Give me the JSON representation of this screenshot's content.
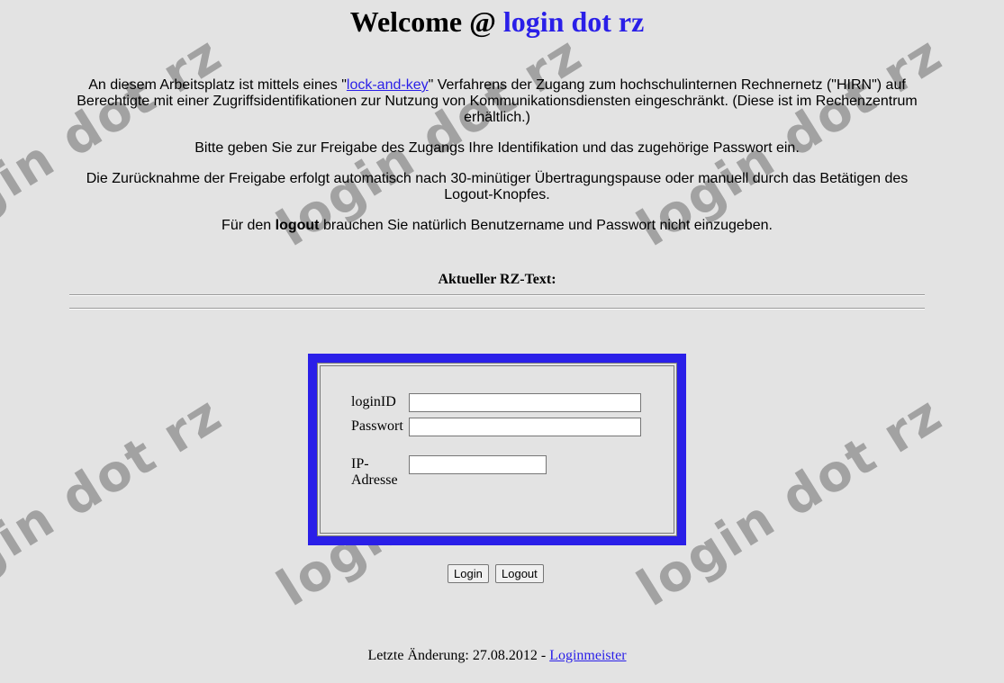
{
  "watermark": {
    "text": "login dot rz"
  },
  "header": {
    "welcome_prefix": "Welcome @ ",
    "brand": "login dot rz"
  },
  "intro": {
    "p1_before_link": "An diesem Arbeitsplatz ist mittels eines \"",
    "p1_link": "lock-and-key",
    "p1_after_link": "\" Verfahrens der Zugang zum hochschulinternen Rechnernetz (\"HIRN\") auf Berechtigte mit einer Zugriffsidentifikationen zur Nutzung von Kommunikationsdiensten eingeschränkt. (Diese ist im Rechenzentrum erhältlich.)",
    "p2": "Bitte geben Sie zur Freigabe des Zugangs Ihre Identifikation und das zugehörige Passwort ein.",
    "p3": "Die Zurücknahme der Freigabe erfolgt automatisch nach 30-minütiger Übertragungspause oder manuell durch das Betätigen des Logout-Knopfes.",
    "p4_before_bold": "Für den ",
    "p4_bold": "logout",
    "p4_after_bold": " brauchen Sie natürlich Benutzername und Passwort nicht einzugeben."
  },
  "rz_text": {
    "heading": "Aktueller RZ-Text:"
  },
  "login_form": {
    "login_id_label": "loginID",
    "login_id_value": "",
    "password_label": "Passwort",
    "password_value": "",
    "ip_label_line1": "IP-",
    "ip_label_line2": "Adresse",
    "ip_value": ""
  },
  "buttons": {
    "login": "Login",
    "logout": "Logout"
  },
  "footer": {
    "text": "Letzte Änderung: 27.08.2012 - ",
    "link": "Loginmeister"
  },
  "colors": {
    "background": "#e3e3e3",
    "accent": "#2a1fe8",
    "watermark": "#a2a2a2"
  }
}
